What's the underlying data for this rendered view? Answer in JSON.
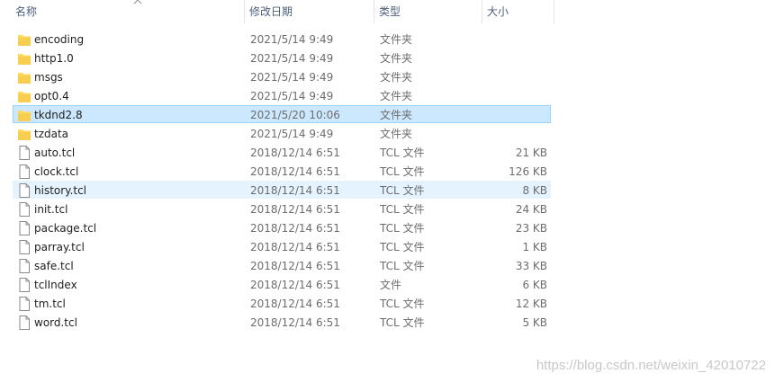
{
  "columns": {
    "name": "名称",
    "date": "修改日期",
    "type": "类型",
    "size": "大小"
  },
  "files": [
    {
      "name": "encoding",
      "date": "2021/5/14 9:49",
      "type": "文件夹",
      "size": "",
      "kind": "folder-icon"
    },
    {
      "name": "http1.0",
      "date": "2021/5/14 9:49",
      "type": "文件夹",
      "size": "",
      "kind": "folder-icon"
    },
    {
      "name": "msgs",
      "date": "2021/5/14 9:49",
      "type": "文件夹",
      "size": "",
      "kind": "folder-icon"
    },
    {
      "name": "opt0.4",
      "date": "2021/5/14 9:49",
      "type": "文件夹",
      "size": "",
      "kind": "folder-icon"
    },
    {
      "name": "tkdnd2.8",
      "date": "2021/5/20 10:06",
      "type": "文件夹",
      "size": "",
      "kind": "folder-icon",
      "state": "selected"
    },
    {
      "name": "tzdata",
      "date": "2021/5/14 9:49",
      "type": "文件夹",
      "size": "",
      "kind": "folder-icon"
    },
    {
      "name": "auto.tcl",
      "date": "2018/12/14 6:51",
      "type": "TCL 文件",
      "size": "21 KB",
      "kind": "file-icon"
    },
    {
      "name": "clock.tcl",
      "date": "2018/12/14 6:51",
      "type": "TCL 文件",
      "size": "126 KB",
      "kind": "file-icon"
    },
    {
      "name": "history.tcl",
      "date": "2018/12/14 6:51",
      "type": "TCL 文件",
      "size": "8 KB",
      "kind": "file-icon",
      "state": "hover"
    },
    {
      "name": "init.tcl",
      "date": "2018/12/14 6:51",
      "type": "TCL 文件",
      "size": "24 KB",
      "kind": "file-icon"
    },
    {
      "name": "package.tcl",
      "date": "2018/12/14 6:51",
      "type": "TCL 文件",
      "size": "23 KB",
      "kind": "file-icon"
    },
    {
      "name": "parray.tcl",
      "date": "2018/12/14 6:51",
      "type": "TCL 文件",
      "size": "1 KB",
      "kind": "file-icon"
    },
    {
      "name": "safe.tcl",
      "date": "2018/12/14 6:51",
      "type": "TCL 文件",
      "size": "33 KB",
      "kind": "file-icon"
    },
    {
      "name": "tclIndex",
      "date": "2018/12/14 6:51",
      "type": "文件",
      "size": "6 KB",
      "kind": "file-icon"
    },
    {
      "name": "tm.tcl",
      "date": "2018/12/14 6:51",
      "type": "TCL 文件",
      "size": "12 KB",
      "kind": "file-icon"
    },
    {
      "name": "word.tcl",
      "date": "2018/12/14 6:51",
      "type": "TCL 文件",
      "size": "5 KB",
      "kind": "file-icon"
    }
  ],
  "watermark": "https://blog.csdn.net/weixin_42010722",
  "colors": {
    "folder": "#ffd95c",
    "folder_dark": "#e8b93a",
    "selected_bg": "#cce8ff",
    "hover_bg": "#e5f3ff",
    "header_text": "#4c607a"
  }
}
